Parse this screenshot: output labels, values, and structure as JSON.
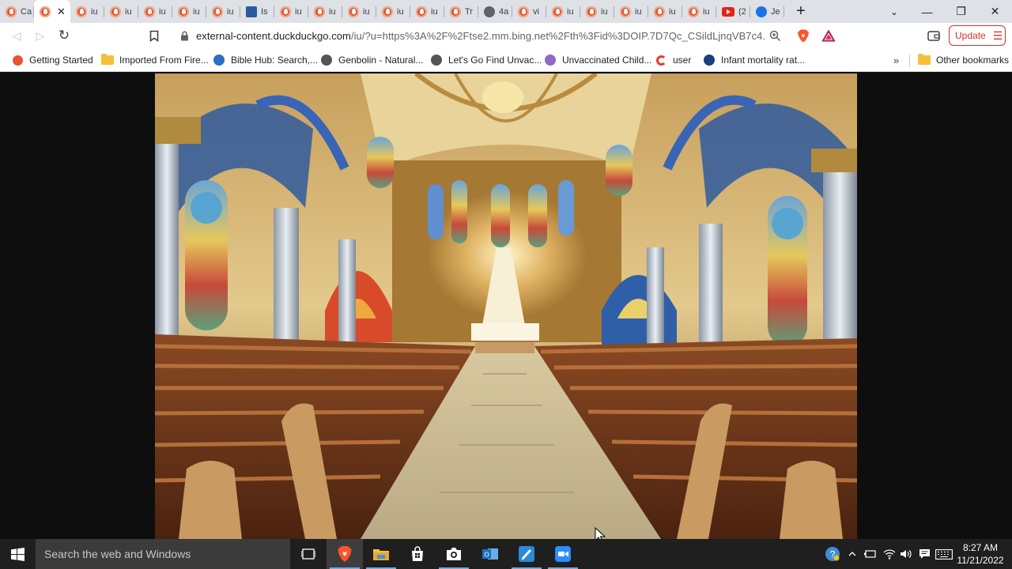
{
  "browser": {
    "tabs": [
      {
        "label": "Ca",
        "icon": "duckduckgo-icon"
      },
      {
        "label": "",
        "icon": "duckduckgo-icon",
        "active": true
      },
      {
        "label": "iu",
        "icon": "duckduckgo-icon"
      },
      {
        "label": "iu",
        "icon": "duckduckgo-icon"
      },
      {
        "label": "iu",
        "icon": "duckduckgo-icon"
      },
      {
        "label": "iu",
        "icon": "duckduckgo-icon"
      },
      {
        "label": "iu",
        "icon": "duckduckgo-icon"
      },
      {
        "label": "Is",
        "icon": "message-icon"
      },
      {
        "label": "iu",
        "icon": "duckduckgo-icon"
      },
      {
        "label": "iu",
        "icon": "duckduckgo-icon"
      },
      {
        "label": "iu",
        "icon": "duckduckgo-icon"
      },
      {
        "label": "iu",
        "icon": "duckduckgo-icon"
      },
      {
        "label": "iu",
        "icon": "duckduckgo-icon"
      },
      {
        "label": "Tr",
        "icon": "duckduckgo-icon"
      },
      {
        "label": "4a",
        "icon": "globe-icon"
      },
      {
        "label": "vi",
        "icon": "duckduckgo-icon"
      },
      {
        "label": "iu",
        "icon": "duckduckgo-icon"
      },
      {
        "label": "iu",
        "icon": "duckduckgo-icon"
      },
      {
        "label": "iu",
        "icon": "duckduckgo-icon"
      },
      {
        "label": "iu",
        "icon": "duckduckgo-icon"
      },
      {
        "label": "iu",
        "icon": "duckduckgo-icon"
      },
      {
        "label": "(2",
        "icon": "youtube-icon"
      },
      {
        "label": "Je",
        "icon": "edge-icon"
      }
    ],
    "new_tab_label": "+",
    "window_controls": {
      "dropdown": "⌄",
      "minimize": "—",
      "maximize": "❐",
      "close": "✕"
    },
    "toolbar": {
      "back": "◁",
      "forward": "▷",
      "reload": "↻",
      "url_host": "external-content.duckduckgo.com",
      "url_path": "/iu/?u=https%3A%2F%2Ftse2.mm.bing.net%2Fth%3Fid%3DOIP.7D7Qc_CSildLjnqVB7c4...",
      "update_label": "Update",
      "menu_glyph": "☰"
    },
    "bookmarks": [
      {
        "label": "Getting Started",
        "icon": "firefox-icon"
      },
      {
        "label": "Imported From Fire...",
        "icon": "folder-icon"
      },
      {
        "label": "Bible Hub: Search,...",
        "icon": "biblehub-icon"
      },
      {
        "label": "Genbolin - Natural...",
        "icon": "globe-icon"
      },
      {
        "label": "Let's Go Find Unvac...",
        "icon": "globe-icon"
      },
      {
        "label": "Unvaccinated Child...",
        "icon": "site-icon"
      },
      {
        "label": "user",
        "icon": "cricket-icon"
      },
      {
        "label": "Infant mortality rat...",
        "icon": "dollar-icon"
      }
    ],
    "bookmarks_more": "»",
    "other_bookmarks": "Other bookmarks"
  },
  "taskbar": {
    "search_placeholder": "Search the web and Windows",
    "clock_time": "8:27 AM",
    "clock_date": "11/21/2022"
  },
  "colors": {
    "tabstrip": "#dee1e6",
    "update_red": "#d93025",
    "taskbar": "#1f1f1f",
    "search_box": "#3b3b3b"
  }
}
